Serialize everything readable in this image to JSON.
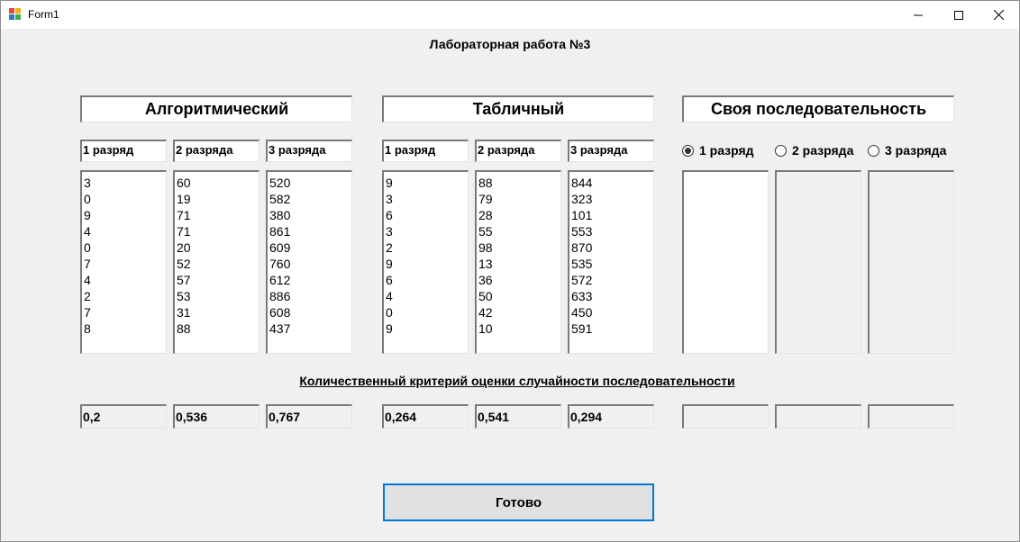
{
  "window": {
    "title": "Form1",
    "controls": {
      "minimize": "minimize-icon",
      "maximize": "maximize-icon",
      "close": "close-icon"
    }
  },
  "main_title": "Лабораторная работа №3",
  "sections": [
    {
      "title": "Алгоритмический"
    },
    {
      "title": "Табличный"
    },
    {
      "title": "Своя последовательность"
    }
  ],
  "column_labels": [
    "1 разряд",
    "2 разряда",
    "3 разряда"
  ],
  "algorithmic": {
    "col1": [
      "3",
      "0",
      "9",
      "4",
      "0",
      "7",
      "4",
      "2",
      "7",
      "8"
    ],
    "col2": [
      "60",
      "19",
      "71",
      "71",
      "20",
      "52",
      "57",
      "53",
      "31",
      "88"
    ],
    "col3": [
      "520",
      "582",
      "380",
      "861",
      "609",
      "760",
      "612",
      "886",
      "608",
      "437"
    ]
  },
  "table": {
    "col1": [
      "9",
      "3",
      "6",
      "3",
      "2",
      "9",
      "6",
      "4",
      "0",
      "9"
    ],
    "col2": [
      "88",
      "79",
      "28",
      "55",
      "98",
      "13",
      "36",
      "50",
      "42",
      "10"
    ],
    "col3": [
      "844",
      "323",
      "101",
      "553",
      "870",
      "535",
      "572",
      "633",
      "450",
      "591"
    ]
  },
  "custom": {
    "radios": [
      {
        "label": "1 разряд",
        "checked": true
      },
      {
        "label": "2 разряда",
        "checked": false
      },
      {
        "label": "3 разряда",
        "checked": false
      }
    ]
  },
  "criteria_title": "Количественный критерий оценки случайности последовательности",
  "results": {
    "algorithmic": [
      "0,2",
      "0,536",
      "0,767"
    ],
    "table": [
      "0,264",
      "0,541",
      "0,294"
    ],
    "custom": [
      "",
      "",
      ""
    ]
  },
  "button_label": "Готово"
}
